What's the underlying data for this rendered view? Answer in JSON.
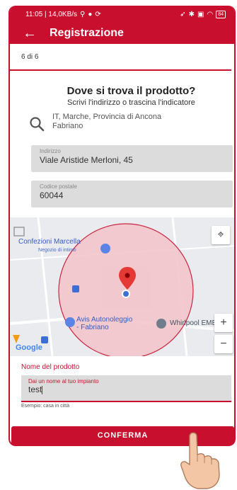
{
  "status_bar": {
    "time": "11:05 | 14,0KB/s",
    "battery": "84"
  },
  "app_bar": {
    "title": "Registrazione"
  },
  "step": "6 di 6",
  "heading": {
    "title": "Dove si trova il prodotto?",
    "subtitle": "Scrivi l'indirizzo o trascina l'indicatore"
  },
  "location": {
    "line1": "IT, Marche, Provincia di Ancona",
    "line2": "Fabriano"
  },
  "address_field": {
    "label": "Indirizzo",
    "value": "Viale Aristide Merloni, 45"
  },
  "postal_field": {
    "label": "Codice postale",
    "value": "60044"
  },
  "map": {
    "labels": {
      "confezioni": "Confezioni Marcella",
      "negozio": "Negozio di intimo",
      "avis_1": "Avis Autonoleggio",
      "avis_2": "- Fabriano",
      "whirlpool": "Whirlpool EMEA S"
    },
    "google": "Google",
    "zoom_in": "+",
    "zoom_out": "−"
  },
  "product_name": {
    "section_label": "Nome del prodotto",
    "field_label": "Dai un nome al tuo impianto",
    "value": "test",
    "hint": "Esempio: casa in città"
  },
  "confirm_label": "CONFERMA",
  "colors": {
    "brand": "#c8102e",
    "field_bg": "#dcdcdc",
    "map_circle": "#f4c6cc"
  }
}
